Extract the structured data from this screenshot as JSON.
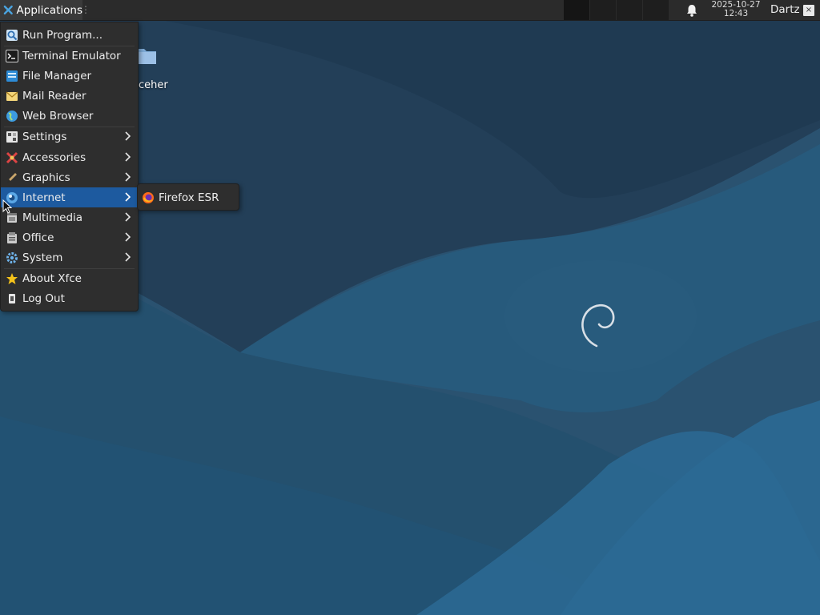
{
  "panel": {
    "applications_label": "Applications",
    "clock_date": "2025-10-27",
    "clock_time": "12:43",
    "user_name": "Dartz",
    "close_glyph": "×",
    "workspace_count": 4,
    "active_workspace": 1
  },
  "desktop": {
    "icon_label": "ceher",
    "background_color": "#274e6c"
  },
  "menu": {
    "items": [
      {
        "label": "Run Program...",
        "icon": "run-icon"
      },
      {
        "label": "Terminal Emulator",
        "icon": "terminal-icon"
      },
      {
        "label": "File Manager",
        "icon": "file-manager-icon"
      },
      {
        "label": "Mail Reader",
        "icon": "mail-icon"
      },
      {
        "label": "Web Browser",
        "icon": "web-browser-icon"
      },
      {
        "label": "Settings",
        "icon": "settings-icon",
        "submenu": true
      },
      {
        "label": "Accessories",
        "icon": "accessories-icon",
        "submenu": true
      },
      {
        "label": "Graphics",
        "icon": "graphics-icon",
        "submenu": true
      },
      {
        "label": "Internet",
        "icon": "internet-icon",
        "submenu": true,
        "highlighted": true
      },
      {
        "label": "Multimedia",
        "icon": "multimedia-icon",
        "submenu": true
      },
      {
        "label": "Office",
        "icon": "office-icon",
        "submenu": true
      },
      {
        "label": "System",
        "icon": "system-icon",
        "submenu": true
      },
      {
        "label": "About Xfce",
        "icon": "star-icon"
      },
      {
        "label": "Log Out",
        "icon": "logout-icon"
      }
    ],
    "highlight_color": "#1d5a9f"
  },
  "submenu": {
    "items": [
      {
        "label": "Firefox ESR",
        "icon": "firefox-icon"
      }
    ]
  }
}
